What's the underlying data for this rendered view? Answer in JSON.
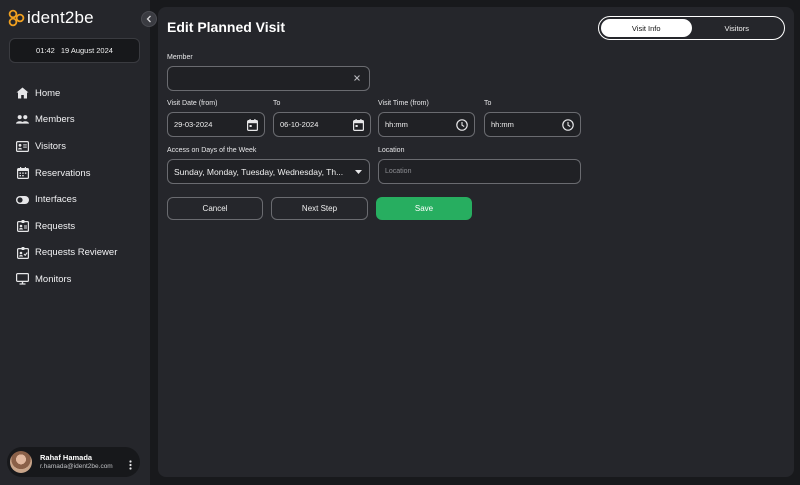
{
  "sidebar": {
    "logo_text": "ident2be",
    "clock": {
      "time": "01:42",
      "date": "19 August 2024"
    },
    "items": [
      {
        "label": "Home",
        "icon": "home-icon"
      },
      {
        "label": "Members",
        "icon": "members-icon"
      },
      {
        "label": "Visitors",
        "icon": "id-card-icon"
      },
      {
        "label": "Reservations",
        "icon": "calendar-icon"
      },
      {
        "label": "Interfaces",
        "icon": "toggle-icon"
      },
      {
        "label": "Requests",
        "icon": "badge-icon"
      },
      {
        "label": "Requests Reviewer",
        "icon": "badge-check-icon"
      },
      {
        "label": "Monitors",
        "icon": "monitor-icon"
      }
    ],
    "user": {
      "name": "Rahaf Hamada",
      "email": "r.hamada@ident2be.com"
    }
  },
  "header": {
    "title": "Edit Planned Visit",
    "tabs": [
      {
        "label": "Visit Info",
        "active": true
      },
      {
        "label": "Visitors",
        "active": false
      }
    ]
  },
  "form": {
    "member": {
      "label": "Member",
      "value": ""
    },
    "visit_date_from": {
      "label": "Visit Date (from)",
      "value": "29-03-2024"
    },
    "visit_date_to": {
      "label": "To",
      "value": "06-10-2024"
    },
    "visit_time_from": {
      "label": "Visit Time (from)",
      "placeholder": "hh:mm"
    },
    "visit_time_to": {
      "label": "To",
      "placeholder": "hh:mm"
    },
    "access_days": {
      "label": "Access on Days of the Week",
      "value": "Sunday, Monday, Tuesday, Wednesday, Th..."
    },
    "location": {
      "label": "Location",
      "placeholder": "Location"
    }
  },
  "actions": {
    "cancel": "Cancel",
    "next": "Next Step",
    "save": "Save"
  },
  "colors": {
    "accent": "#27ae60",
    "logo_orange": "#f0a020",
    "background": "#18191c",
    "panel": "#25262b"
  }
}
